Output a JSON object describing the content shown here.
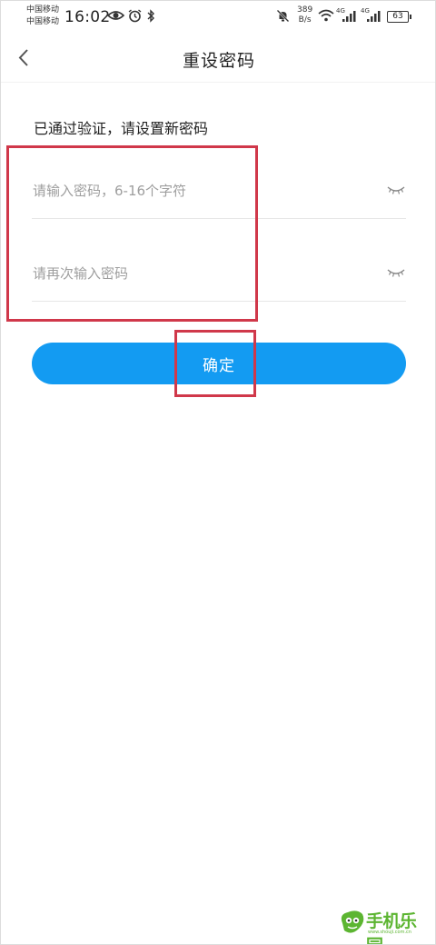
{
  "status_bar": {
    "carrier_1": "中国移动",
    "carrier_2": "中国移动",
    "time": "16:02",
    "net_speed_value": "389",
    "net_speed_unit": "B/s",
    "network_tag_1": "4G",
    "network_tag_2": "4G",
    "battery": "63"
  },
  "nav": {
    "title": "重设密码"
  },
  "form": {
    "instruction": "已通过验证，请设置新密码",
    "password_placeholder": "请输入密码，6-16个字符",
    "password_value": "",
    "confirm_placeholder": "请再次输入密码",
    "confirm_value": "",
    "submit_label": "确定"
  },
  "watermark": {
    "text": "手机乐园",
    "url": "www.shouji.com.cn"
  },
  "colors": {
    "accent": "#139bf2",
    "highlight": "#d0384a",
    "watermark": "#5cb531"
  }
}
